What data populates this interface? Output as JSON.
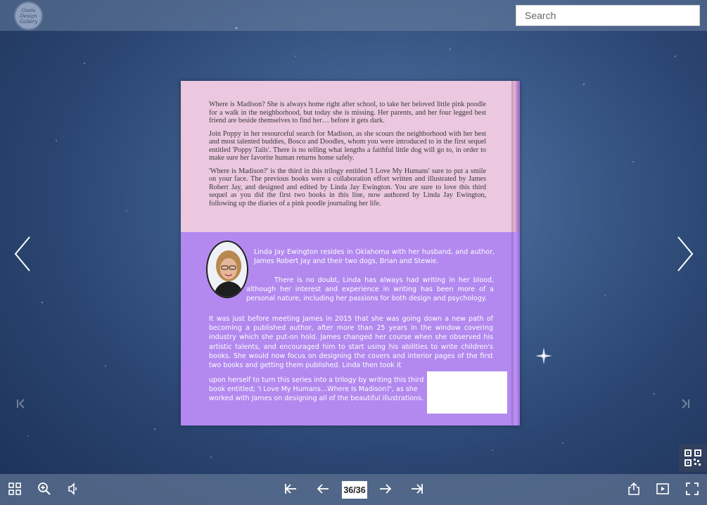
{
  "logo": {
    "text_line1": "Oasis",
    "text_line2": "Design",
    "text_line3": "Gallery"
  },
  "search": {
    "placeholder": "Search"
  },
  "book": {
    "back_cover": {
      "synopsis": [
        "Where is Madison? She is always home right after school, to take her beloved little pink poodle for a walk in the neighborhood, but today she is missing. Her parents, and her four legged best friend are beside themselves to find her… before it gets dark.",
        "Join Poppy in her resourceful search for Madison, as she scours the neighborhood with her best and most talented buddies, Bosco and Doodles, whom you were introduced to in the first sequel entitled 'Poppy Tails'. There is no telling what lengths a faithful little dog will go to, in order to make sure her favorite human returns home safely.",
        "'Where is Madison?' is the third in this trilogy entitled 'I Love My Humans' sure to put a smile on your face. The previous books were a collaboration effort written and illustrated by James Robert Jay, and designed and edited by Linda Jay Ewington. You are sure to love this third sequel as you did the first two books in this line, now authored by Linda Jay Ewington, following up the diaries of a pink poodle journaling her life."
      ],
      "bio": [
        "Linda Jay Ewington resides in Oklahoma with her husband, and author, James Robert Jay and their two dogs, Brian and Stewie.",
        "There is no doubt, Linda has always had writing in her blood, although her interest and experience in writing has been more of a personal nature, including her passions for both design and psychology.",
        "It was just before meeting James in 2015 that she was going down a new path of becoming a published author, after more than 25 years in the window covering industry which she put-on hold. James changed her course when she observed his  artistic  talents, and  encouraged him to start using his abilities to write children's books. She would now focus on designing the covers and interior pages of the first two books and getting them published. Linda then took it",
        "upon herself to turn this series into a trilogy by writing this third book entitled; 'I Love My Humans…Where Is Madison?', as she worked with James on designing all of the beautiful illustrations."
      ]
    }
  },
  "pager": {
    "current": "36/36"
  },
  "icons": {
    "toolbar_left": [
      "thumbnails-icon",
      "zoom-in-icon",
      "sound-icon"
    ],
    "pager": [
      "first-page-icon",
      "previous-page-icon",
      "next-page-icon",
      "last-page-icon"
    ],
    "toolbar_right": [
      "share-icon",
      "autoplay-icon",
      "fullscreen-icon"
    ]
  },
  "colors": {
    "cover_top": "#ebc8df",
    "cover_bottom": "#b389ef",
    "toolbar": "#5f7391"
  }
}
